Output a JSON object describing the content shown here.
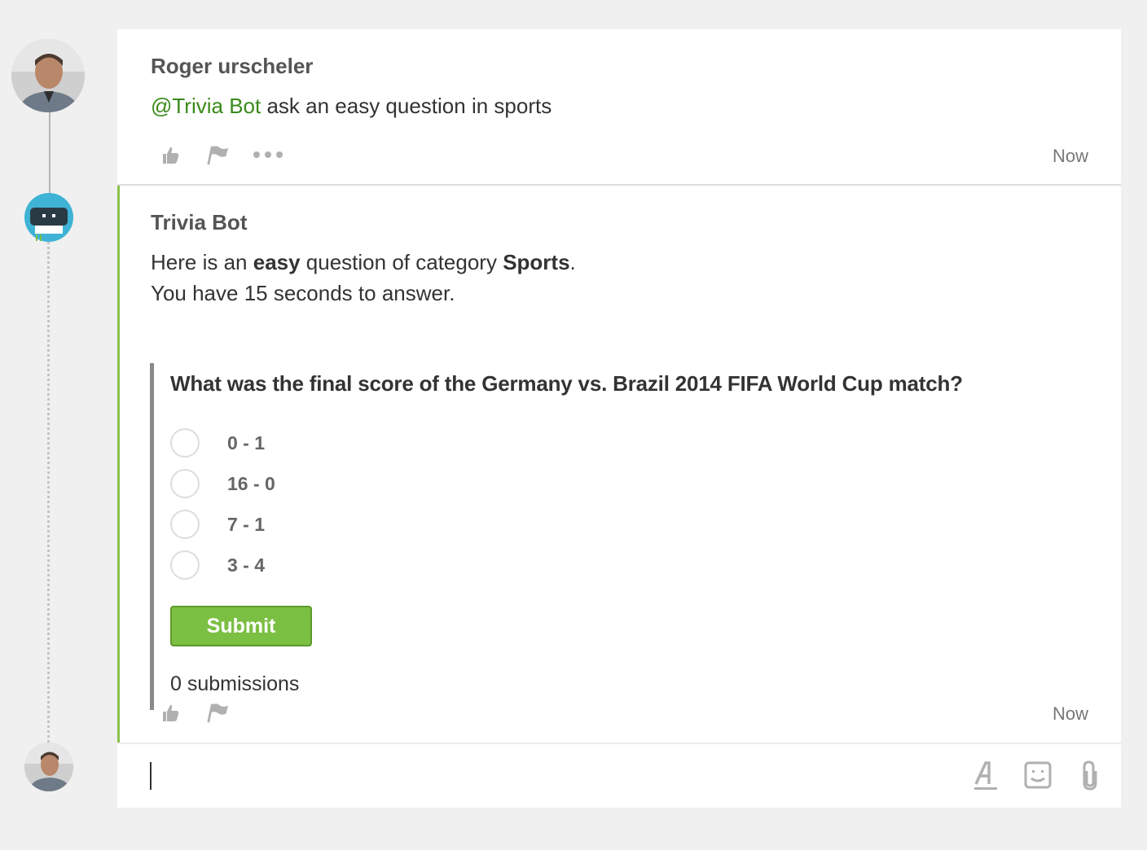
{
  "messages": [
    {
      "author": "Roger urscheler",
      "mention": "@Trivia Bot",
      "text": " ask an easy question in sports",
      "timestamp": "Now"
    },
    {
      "author": "Trivia Bot",
      "line1_prefix": "Here is an ",
      "difficulty": "easy",
      "line1_middle": " question of category ",
      "category": "Sports",
      "line1_suffix": ".",
      "line2": "You have 15 seconds to answer.",
      "timestamp": "Now"
    }
  ],
  "quiz": {
    "question": "What was the final score of the Germany vs. Brazil 2014 FIFA World Cup match?",
    "options": [
      "0 - 1",
      "16 - 0",
      "7 - 1",
      "3 - 4"
    ],
    "submit_label": "Submit",
    "submissions": "0 submissions"
  },
  "colors": {
    "accent_green": "#7bbf43",
    "mention_green": "#3a8a1a",
    "bot_blue": "#3eb3d6"
  },
  "icons": {
    "like": "thumbs-up-icon",
    "flag": "flag-icon",
    "more": "more-icon",
    "format": "format-text-icon",
    "emoji": "emoji-icon",
    "attach": "paperclip-icon"
  }
}
